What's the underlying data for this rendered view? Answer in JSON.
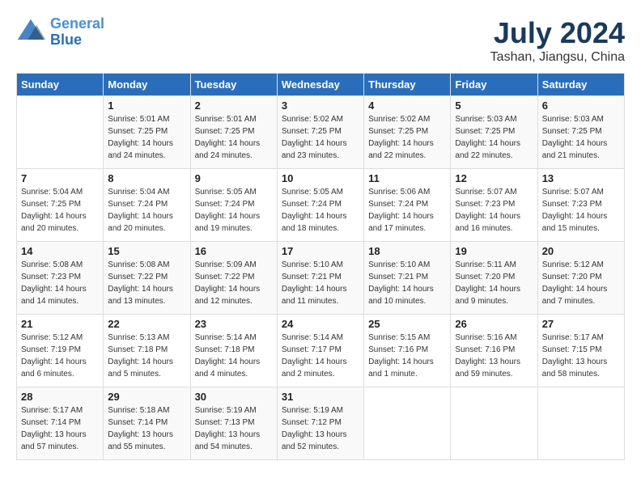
{
  "header": {
    "logo_line1": "General",
    "logo_line2": "Blue",
    "month_year": "July 2024",
    "location": "Tashan, Jiangsu, China"
  },
  "days_of_week": [
    "Sunday",
    "Monday",
    "Tuesday",
    "Wednesday",
    "Thursday",
    "Friday",
    "Saturday"
  ],
  "weeks": [
    [
      {
        "day": "",
        "info": ""
      },
      {
        "day": "1",
        "info": "Sunrise: 5:01 AM\nSunset: 7:25 PM\nDaylight: 14 hours\nand 24 minutes."
      },
      {
        "day": "2",
        "info": "Sunrise: 5:01 AM\nSunset: 7:25 PM\nDaylight: 14 hours\nand 24 minutes."
      },
      {
        "day": "3",
        "info": "Sunrise: 5:02 AM\nSunset: 7:25 PM\nDaylight: 14 hours\nand 23 minutes."
      },
      {
        "day": "4",
        "info": "Sunrise: 5:02 AM\nSunset: 7:25 PM\nDaylight: 14 hours\nand 22 minutes."
      },
      {
        "day": "5",
        "info": "Sunrise: 5:03 AM\nSunset: 7:25 PM\nDaylight: 14 hours\nand 22 minutes."
      },
      {
        "day": "6",
        "info": "Sunrise: 5:03 AM\nSunset: 7:25 PM\nDaylight: 14 hours\nand 21 minutes."
      }
    ],
    [
      {
        "day": "7",
        "info": "Sunrise: 5:04 AM\nSunset: 7:25 PM\nDaylight: 14 hours\nand 20 minutes."
      },
      {
        "day": "8",
        "info": "Sunrise: 5:04 AM\nSunset: 7:24 PM\nDaylight: 14 hours\nand 20 minutes."
      },
      {
        "day": "9",
        "info": "Sunrise: 5:05 AM\nSunset: 7:24 PM\nDaylight: 14 hours\nand 19 minutes."
      },
      {
        "day": "10",
        "info": "Sunrise: 5:05 AM\nSunset: 7:24 PM\nDaylight: 14 hours\nand 18 minutes."
      },
      {
        "day": "11",
        "info": "Sunrise: 5:06 AM\nSunset: 7:24 PM\nDaylight: 14 hours\nand 17 minutes."
      },
      {
        "day": "12",
        "info": "Sunrise: 5:07 AM\nSunset: 7:23 PM\nDaylight: 14 hours\nand 16 minutes."
      },
      {
        "day": "13",
        "info": "Sunrise: 5:07 AM\nSunset: 7:23 PM\nDaylight: 14 hours\nand 15 minutes."
      }
    ],
    [
      {
        "day": "14",
        "info": "Sunrise: 5:08 AM\nSunset: 7:23 PM\nDaylight: 14 hours\nand 14 minutes."
      },
      {
        "day": "15",
        "info": "Sunrise: 5:08 AM\nSunset: 7:22 PM\nDaylight: 14 hours\nand 13 minutes."
      },
      {
        "day": "16",
        "info": "Sunrise: 5:09 AM\nSunset: 7:22 PM\nDaylight: 14 hours\nand 12 minutes."
      },
      {
        "day": "17",
        "info": "Sunrise: 5:10 AM\nSunset: 7:21 PM\nDaylight: 14 hours\nand 11 minutes."
      },
      {
        "day": "18",
        "info": "Sunrise: 5:10 AM\nSunset: 7:21 PM\nDaylight: 14 hours\nand 10 minutes."
      },
      {
        "day": "19",
        "info": "Sunrise: 5:11 AM\nSunset: 7:20 PM\nDaylight: 14 hours\nand 9 minutes."
      },
      {
        "day": "20",
        "info": "Sunrise: 5:12 AM\nSunset: 7:20 PM\nDaylight: 14 hours\nand 7 minutes."
      }
    ],
    [
      {
        "day": "21",
        "info": "Sunrise: 5:12 AM\nSunset: 7:19 PM\nDaylight: 14 hours\nand 6 minutes."
      },
      {
        "day": "22",
        "info": "Sunrise: 5:13 AM\nSunset: 7:18 PM\nDaylight: 14 hours\nand 5 minutes."
      },
      {
        "day": "23",
        "info": "Sunrise: 5:14 AM\nSunset: 7:18 PM\nDaylight: 14 hours\nand 4 minutes."
      },
      {
        "day": "24",
        "info": "Sunrise: 5:14 AM\nSunset: 7:17 PM\nDaylight: 14 hours\nand 2 minutes."
      },
      {
        "day": "25",
        "info": "Sunrise: 5:15 AM\nSunset: 7:16 PM\nDaylight: 14 hours\nand 1 minute."
      },
      {
        "day": "26",
        "info": "Sunrise: 5:16 AM\nSunset: 7:16 PM\nDaylight: 13 hours\nand 59 minutes."
      },
      {
        "day": "27",
        "info": "Sunrise: 5:17 AM\nSunset: 7:15 PM\nDaylight: 13 hours\nand 58 minutes."
      }
    ],
    [
      {
        "day": "28",
        "info": "Sunrise: 5:17 AM\nSunset: 7:14 PM\nDaylight: 13 hours\nand 57 minutes."
      },
      {
        "day": "29",
        "info": "Sunrise: 5:18 AM\nSunset: 7:14 PM\nDaylight: 13 hours\nand 55 minutes."
      },
      {
        "day": "30",
        "info": "Sunrise: 5:19 AM\nSunset: 7:13 PM\nDaylight: 13 hours\nand 54 minutes."
      },
      {
        "day": "31",
        "info": "Sunrise: 5:19 AM\nSunset: 7:12 PM\nDaylight: 13 hours\nand 52 minutes."
      },
      {
        "day": "",
        "info": ""
      },
      {
        "day": "",
        "info": ""
      },
      {
        "day": "",
        "info": ""
      }
    ]
  ]
}
